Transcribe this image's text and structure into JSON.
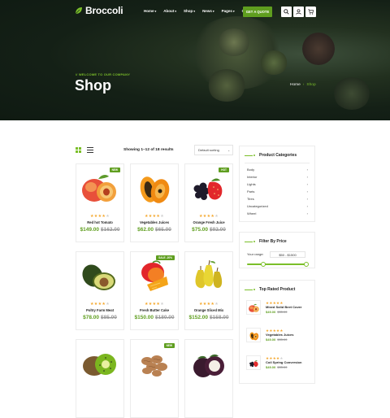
{
  "nav": {
    "logo": "Broccoli",
    "menu": [
      {
        "label": "Home",
        "dropdown": true
      },
      {
        "label": "About",
        "dropdown": true
      },
      {
        "label": "Shop",
        "dropdown": true
      },
      {
        "label": "News",
        "dropdown": true
      },
      {
        "label": "Pages",
        "dropdown": true
      },
      {
        "label": "Contact",
        "dropdown": false
      }
    ],
    "cta": "GET A QUOTE",
    "cart_count": "0"
  },
  "hero": {
    "welcome": "// WELCOME TO OUR COMPANY",
    "title": "Shop",
    "breadcrumb_home": "Home",
    "breadcrumb_sep": "›",
    "breadcrumb_current": "Shop"
  },
  "toolbar": {
    "showing": "Showing 1–12 of 18 results",
    "sort": "Default sorting"
  },
  "products": [
    {
      "name": "Red hot Tomato",
      "price": "$149.00",
      "old_price": "$162.00",
      "badge": "NEW",
      "stars": 4,
      "art": "peach"
    },
    {
      "name": "Vegetables Juices",
      "price": "$62.00",
      "old_price": "$65.00",
      "badge": "",
      "stars": 4,
      "art": "papaya"
    },
    {
      "name": "Orange Fresh Juice",
      "price": "$75.00",
      "old_price": "$92.00",
      "badge": "HOT",
      "stars": 4,
      "art": "berries"
    },
    {
      "name": "Poltry Farm Meat",
      "price": "$78.00",
      "old_price": "$85.00",
      "badge": "",
      "stars": 4,
      "art": "avocado"
    },
    {
      "name": "Fresh Butter Cake",
      "price": "$150.00",
      "old_price": "$180.00",
      "badge": "SALE -20%",
      "stars": 4,
      "art": "mango"
    },
    {
      "name": "Orange Sliced Mix",
      "price": "$152.00",
      "old_price": "$158.00",
      "badge": "",
      "stars": 4,
      "art": "pears"
    },
    {
      "name": "",
      "price": "",
      "old_price": "",
      "badge": "",
      "stars": 0,
      "art": "kiwi"
    },
    {
      "name": "",
      "price": "",
      "old_price": "",
      "badge": "NEW",
      "stars": 0,
      "art": "nuts"
    },
    {
      "name": "",
      "price": "",
      "old_price": "",
      "badge": "",
      "stars": 0,
      "art": "mangosteen"
    }
  ],
  "sidebar": {
    "categories_title": "Product Categories",
    "categories": [
      "Body",
      "Interior",
      "Lights",
      "Parts",
      "Tires",
      "Uncategorized",
      "Wheel"
    ],
    "filter_title": "Filter By Price",
    "range_label": "Your range:",
    "range_value": "$50 - $1500",
    "range_low": 0.27,
    "range_high": 0.97,
    "top_rated_title": "Top Rated Product",
    "top_rated": [
      {
        "name": "Mixed Solid Beet Cover",
        "price": "$49.00",
        "old_price": "$55.00",
        "stars": 5,
        "art": "peach"
      },
      {
        "name": "Vegetables Juices",
        "price": "$49.00",
        "old_price": "$55.00",
        "stars": 5,
        "art": "papaya"
      },
      {
        "name": "Coil Spring Conversion",
        "price": "$49.00",
        "old_price": "$55.00",
        "stars": 4,
        "art": "berries"
      }
    ]
  },
  "colors": {
    "accent": "#5f9e1f",
    "accent_light": "#7bbf2a",
    "star": "#f4a72c",
    "hero_bg": "#142016"
  }
}
